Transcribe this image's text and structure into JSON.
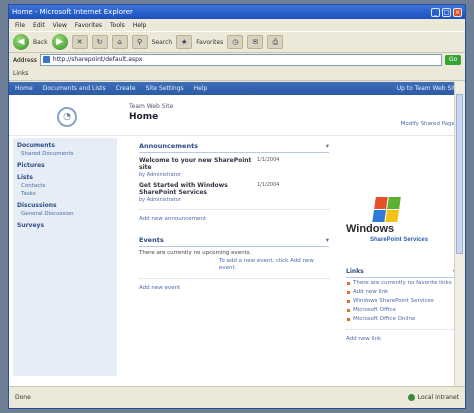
{
  "window": {
    "title": "Home - Microsoft Internet Explorer"
  },
  "menu": [
    "File",
    "Edit",
    "View",
    "Favorites",
    "Tools",
    "Help"
  ],
  "toolbar": {
    "back": "Back",
    "search": "Search",
    "favorites": "Favorites"
  },
  "address": {
    "label": "Address",
    "url": "http://sharepoint/default.aspx",
    "go": "Go"
  },
  "links": {
    "label": "Links"
  },
  "sharepoint": {
    "topnav": [
      "Home",
      "Documents and Lists",
      "Create",
      "Site Settings",
      "Help"
    ],
    "topnav_right": "Up to Team Web Site",
    "breadcrumb": "Team Web Site",
    "page_title": "Home",
    "modify_link": "Modify Shared Page",
    "leftnav": [
      {
        "heading": "Documents",
        "items": [
          "Shared Documents"
        ]
      },
      {
        "heading": "Pictures",
        "items": []
      },
      {
        "heading": "Lists",
        "items": [
          "Contacts",
          "Tasks"
        ]
      },
      {
        "heading": "Discussions",
        "items": [
          "General Discussion"
        ]
      },
      {
        "heading": "Surveys",
        "items": []
      }
    ],
    "announcements": {
      "title": "Announcements",
      "items": [
        {
          "title": "Welcome to your new SharePoint site",
          "by": "by Administrator",
          "date": "1/1/2004"
        },
        {
          "title": "Get Started with Windows SharePoint Services",
          "by": "by Administrator",
          "date": "1/1/2004"
        }
      ],
      "add": "Add new announcement"
    },
    "events": {
      "title": "Events",
      "empty": "There are currently no upcoming events.",
      "note": "To add a new event, click Add new event.",
      "add": "Add new event"
    },
    "logo": {
      "line1": "Windows",
      "line2": "SharePoint Services"
    },
    "links": {
      "title": "Links",
      "items": [
        "There are currently no favorite links",
        "Add new link",
        "Windows SharePoint Services",
        "Microsoft Office",
        "Microsoft Office Online"
      ],
      "add": "Add new link"
    }
  },
  "status": {
    "left": "Done",
    "zone": "Local intranet"
  }
}
